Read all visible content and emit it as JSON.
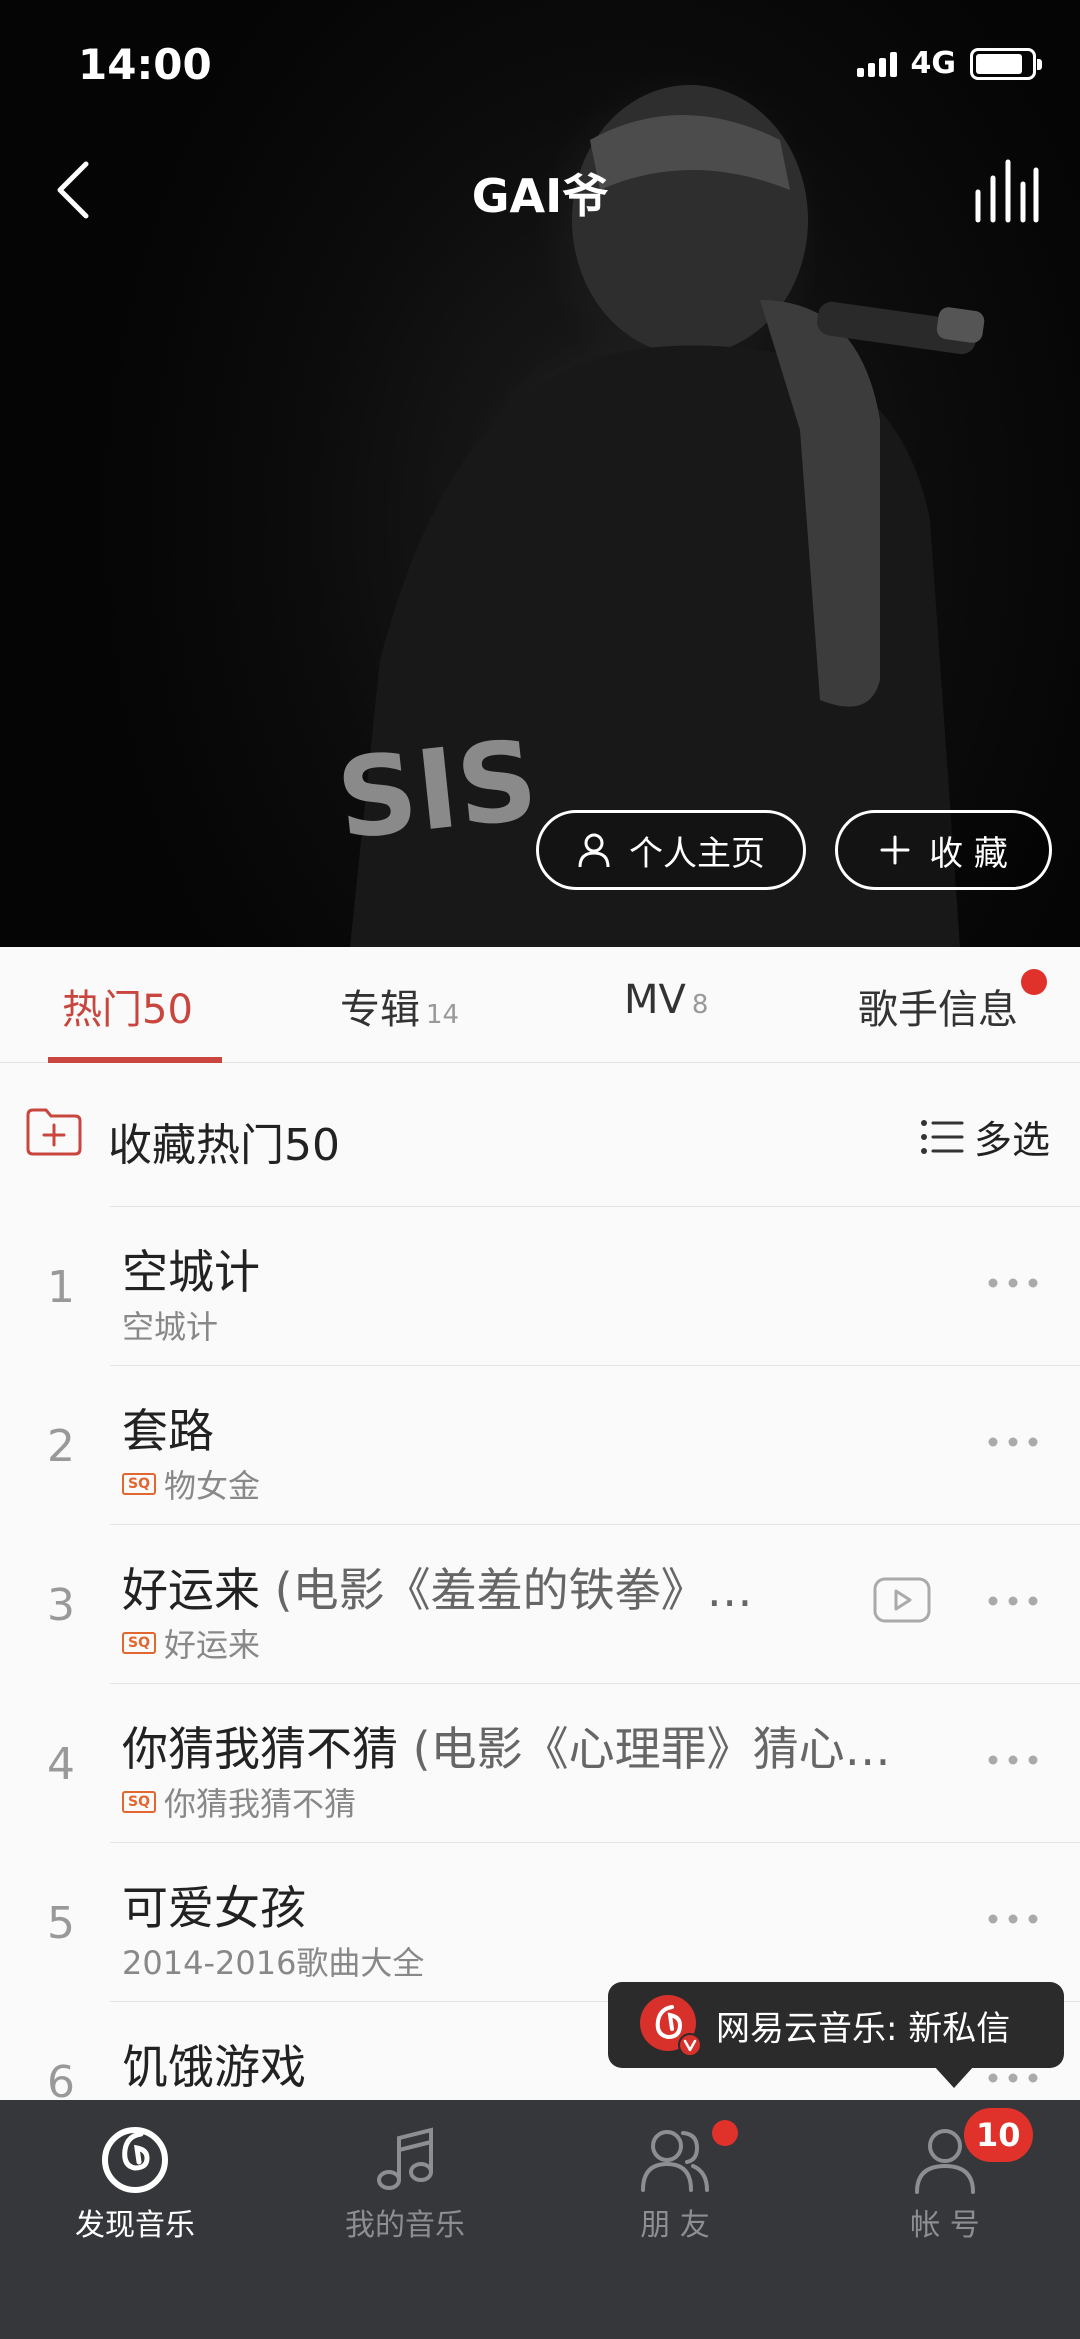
{
  "status_bar": {
    "time": "14:00",
    "network": "4G",
    "battery_level": 0.85
  },
  "header": {
    "title": "GAI爷"
  },
  "hero": {
    "home_label": "个人主页",
    "fav_label": "收 藏",
    "shirt_text": "SIS"
  },
  "tabs": [
    {
      "label": "热门50",
      "count": ""
    },
    {
      "label": "专辑",
      "count": "14"
    },
    {
      "label": "MV",
      "count": "8"
    },
    {
      "label": "歌手信息",
      "count": ""
    }
  ],
  "collect": {
    "label": "收藏热门50",
    "multi_select": "多选"
  },
  "songs": [
    {
      "index": "1",
      "title": "空城计",
      "note": "",
      "subtitle": "空城计",
      "sq": false,
      "mv": false
    },
    {
      "index": "2",
      "title": "套路",
      "note": "",
      "subtitle": "物女金",
      "sq": true,
      "mv": false
    },
    {
      "index": "3",
      "title": "好运来",
      "note": " (电影《羞羞的铁拳》…",
      "subtitle": "好运来",
      "sq": true,
      "mv": true
    },
    {
      "index": "4",
      "title": "你猜我猜不猜",
      "note": " (电影《心理罪》猜心…",
      "subtitle": "你猜我猜不猜",
      "sq": true,
      "mv": false
    },
    {
      "index": "5",
      "title": "可爱女孩",
      "note": "",
      "subtitle": "2014-2016歌曲大全",
      "sq": false,
      "mv": false
    },
    {
      "index": "6",
      "title": "饥饿游戏",
      "note": "",
      "subtitle": "",
      "sq": false,
      "mv": false
    }
  ],
  "sq_badge": "SQ",
  "toast": {
    "text": "网易云音乐: 新私信"
  },
  "bottom_nav": [
    {
      "label": "发现音乐",
      "icon": "netease-logo-icon",
      "active": true
    },
    {
      "label": "我的音乐",
      "icon": "music-note-icon",
      "active": false
    },
    {
      "label": "朋 友",
      "icon": "friends-icon",
      "active": false
    },
    {
      "label": "帐 号",
      "icon": "account-icon",
      "active": false
    }
  ],
  "account_badge": "10",
  "colors": {
    "accent": "#c8463e",
    "badge": "#e0312b",
    "nav_bg": "#36373a"
  }
}
